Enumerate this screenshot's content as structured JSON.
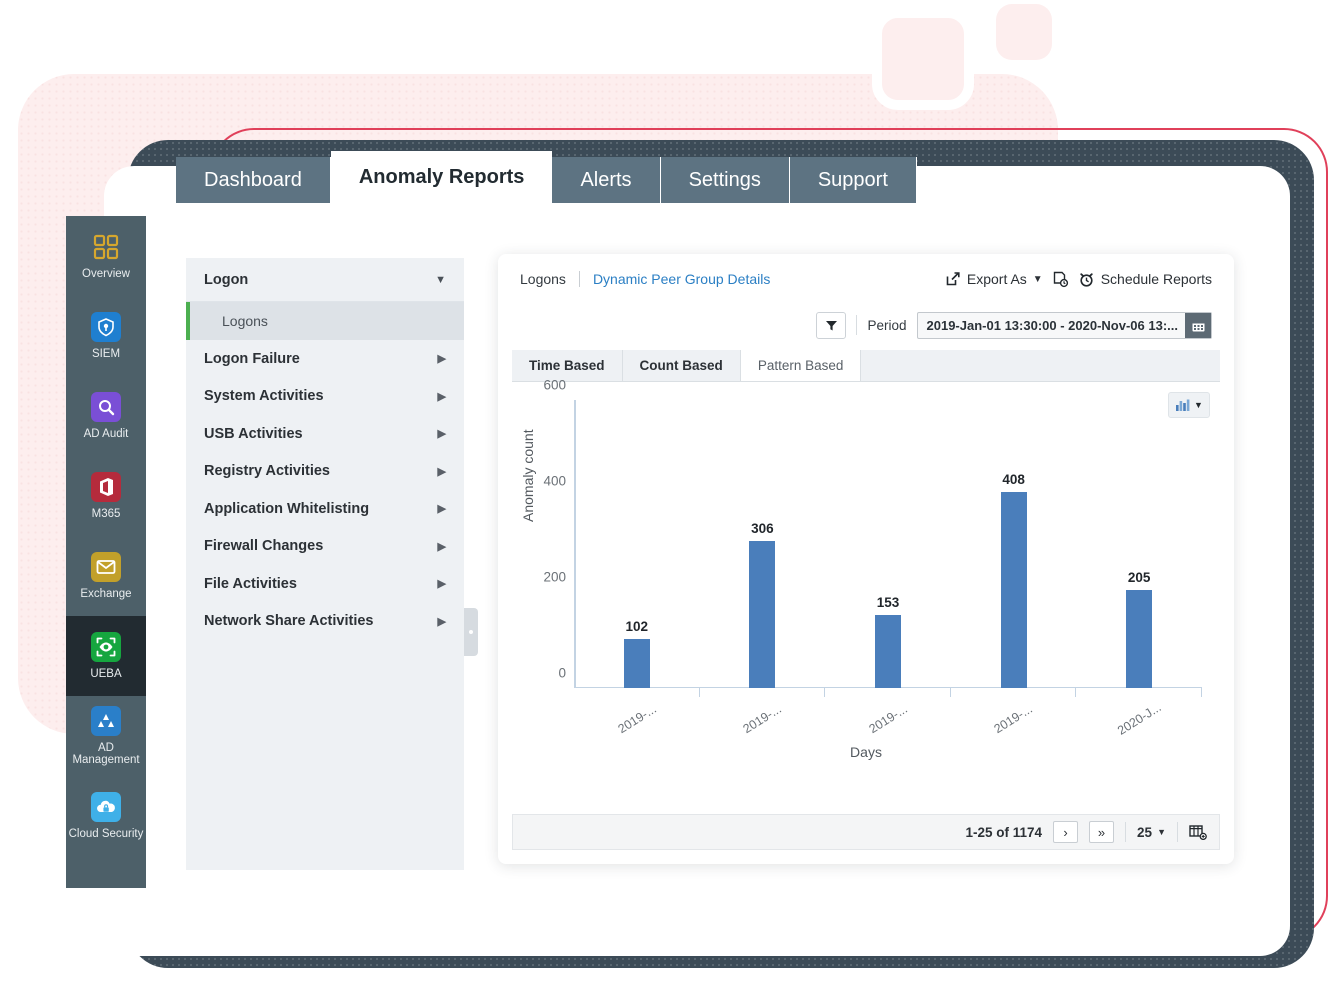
{
  "top_tabs": [
    {
      "label": "Dashboard",
      "active": false
    },
    {
      "label": "Anomaly Reports",
      "active": true
    },
    {
      "label": "Alerts",
      "active": false
    },
    {
      "label": "Settings",
      "active": false
    },
    {
      "label": "Support",
      "active": false
    }
  ],
  "rail": {
    "items": [
      {
        "label": "Overview",
        "icon": "grid-icon",
        "active": false
      },
      {
        "label": "SIEM",
        "icon": "shield-icon",
        "active": false
      },
      {
        "label": "AD Audit",
        "icon": "magnifier-icon",
        "active": false
      },
      {
        "label": "M365",
        "icon": "office-icon",
        "active": false
      },
      {
        "label": "Exchange",
        "icon": "envelope-icon",
        "active": false
      },
      {
        "label": "UEBA",
        "icon": "eye-icon",
        "active": true
      },
      {
        "label": "AD Management",
        "icon": "people-icon",
        "active": false
      },
      {
        "label": "Cloud Security",
        "icon": "cloud-lock-icon",
        "active": false
      }
    ]
  },
  "tree": {
    "header": "Logon",
    "selected": "Logons",
    "items": [
      "Logon Failure",
      "System Activities",
      "USB Activities",
      "Registry Activities",
      "Application Whitelisting",
      "Firewall Changes",
      "File Activities",
      "Network Share Activities"
    ]
  },
  "card": {
    "breadcrumb_current": "Logons",
    "breadcrumb_link": "Dynamic Peer Group Details",
    "export_label": "Export As",
    "schedule_label": "Schedule Reports",
    "period_label": "Period",
    "period_value": "2019-Jan-01 13:30:00 - 2020-Nov-06 13:...",
    "tabs": [
      {
        "label": "Time Based",
        "active": false
      },
      {
        "label": "Count Based",
        "active": false
      },
      {
        "label": "Pattern Based",
        "active": true
      }
    ],
    "pager": {
      "range": "1-25 of 1174",
      "next": "›",
      "last": "»",
      "page_size": "25"
    }
  },
  "chart_data": {
    "type": "bar",
    "title": "",
    "xlabel": "Days",
    "ylabel": "Anomaly count",
    "categories": [
      "2019-...",
      "2019-...",
      "2019-...",
      "2019-...",
      "2020-J..."
    ],
    "values": [
      102,
      306,
      153,
      408,
      205
    ],
    "ylim": [
      0,
      600
    ],
    "yticks": [
      0,
      200,
      400,
      600
    ],
    "grid": false,
    "legend": "none",
    "bar_color": "#4a7ebb"
  },
  "colors": {
    "topbar": "#5d7382",
    "rail": "#4d6069",
    "accent_link": "#2b7fc4",
    "bar": "#4a7ebb",
    "selected_marker": "#4caf50",
    "deco_pink": "#fdeeee",
    "deco_dark": "#3c4b57",
    "deco_red": "#e0405a"
  }
}
